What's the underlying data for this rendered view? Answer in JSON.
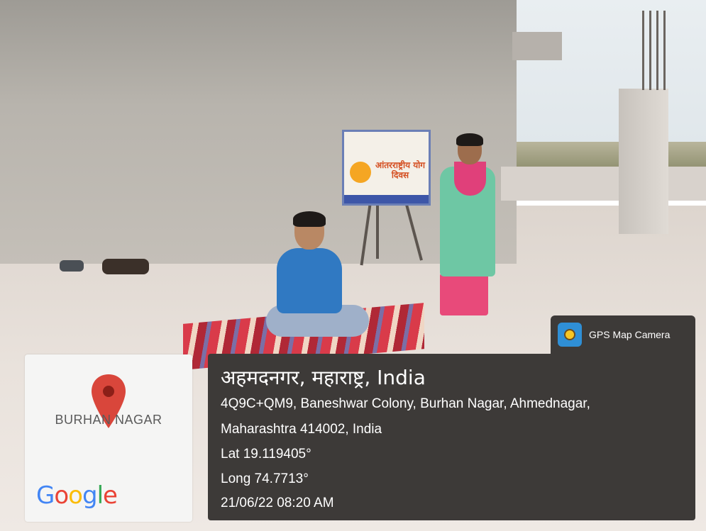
{
  "overlay": {
    "brand_label": "GPS Map Camera",
    "place": "अहमदनगर, महाराष्ट्र, India",
    "address_line1": "4Q9C+QM9, Baneshwar Colony, Burhan Nagar, Ahmednagar,",
    "address_line2": "Maharashtra 414002, India",
    "latitude": "Lat 19.119405°",
    "longitude": "Long 74.7713°",
    "datetime": "21/06/22 08:20 AM"
  },
  "map": {
    "area_label": "BURHAN NAGAR",
    "provider_logo": "Google",
    "pin_color": "#d9463b"
  },
  "banner": {
    "title": "आंतरराष्ट्रीय योग दिवस"
  },
  "icons": [
    "map-pin-icon",
    "gps-camera-icon"
  ]
}
